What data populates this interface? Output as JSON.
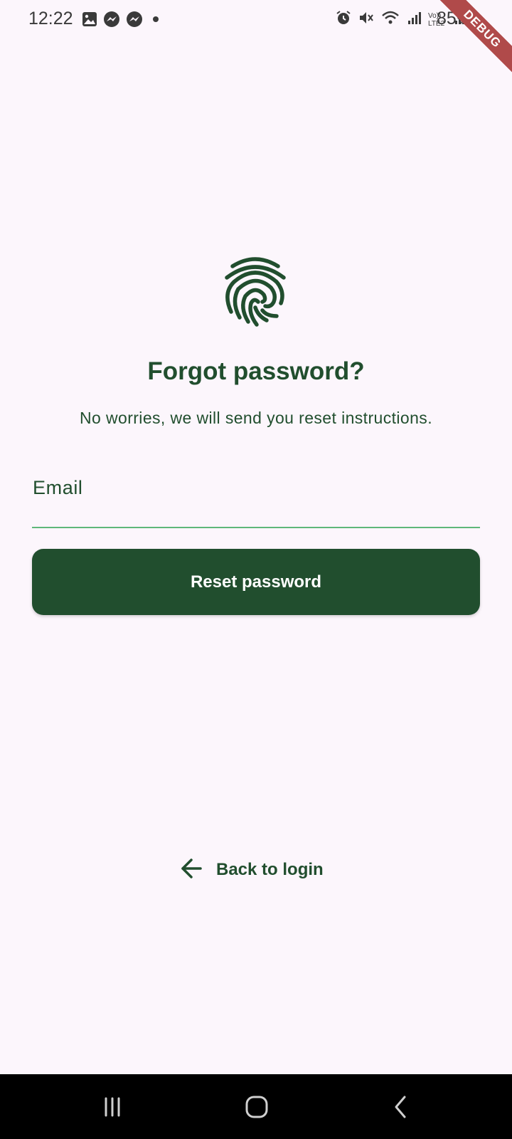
{
  "status_bar": {
    "time": "12:22",
    "battery": "85%",
    "left_icons": [
      "gallery-icon",
      "messenger-icon",
      "messenger-icon",
      "dot-icon"
    ],
    "right_icons": [
      "alarm-icon",
      "mute-icon",
      "wifi-icon",
      "signal-icon",
      "volte-icon",
      "signal-icon",
      "battery-icon"
    ],
    "volte_label": "Vo)) LTE2"
  },
  "debug_banner": "DEBUG",
  "logo_icon": "fingerprint-icon",
  "title": "Forgot password?",
  "subtitle": "No worries, we will send you reset instructions.",
  "email": {
    "label": "Email",
    "value": ""
  },
  "reset_button": "Reset password",
  "back_link": {
    "label": "Back to login",
    "icon": "arrow-left-icon"
  },
  "nav_bar": {
    "buttons": [
      "recent-apps-icon",
      "home-icon",
      "back-icon"
    ]
  },
  "colors": {
    "background": "#fcf6fc",
    "primary": "#214e2e",
    "underline": "#5fb77a",
    "debug": "#b04a4a"
  }
}
